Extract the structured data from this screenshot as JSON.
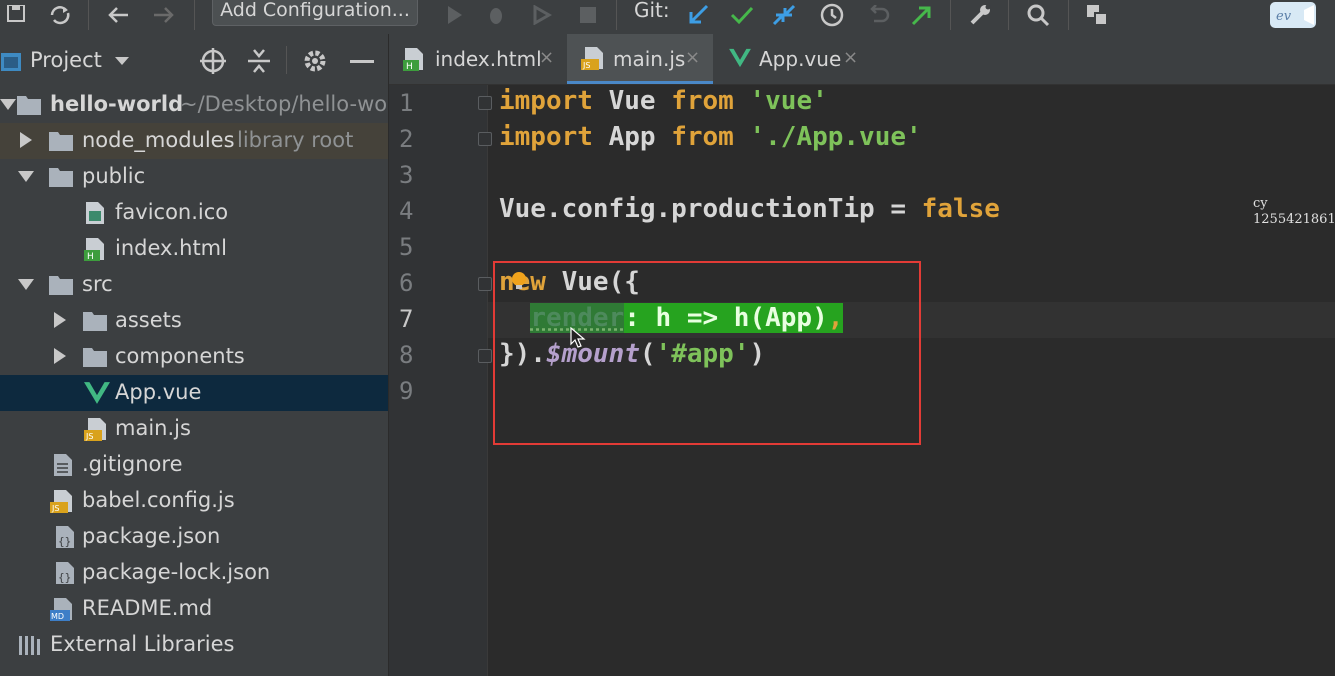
{
  "toolbar": {
    "config_label": "Add Configuration...",
    "git_label": "Git:"
  },
  "project": {
    "title": "Project",
    "tree": [
      {
        "label": "hello-world",
        "sub": "~/Desktop/hello-world",
        "type": "root-folder"
      },
      {
        "label": "node_modules",
        "sub": "library root",
        "type": "folder"
      },
      {
        "label": "public",
        "type": "folder"
      },
      {
        "label": "favicon.ico",
        "type": "image-file"
      },
      {
        "label": "index.html",
        "type": "html-file"
      },
      {
        "label": "src",
        "type": "folder"
      },
      {
        "label": "assets",
        "type": "folder"
      },
      {
        "label": "components",
        "type": "folder"
      },
      {
        "label": "App.vue",
        "type": "vue-file"
      },
      {
        "label": "main.js",
        "type": "js-file"
      },
      {
        "label": ".gitignore",
        "type": "text-file"
      },
      {
        "label": "babel.config.js",
        "type": "js-file"
      },
      {
        "label": "package.json",
        "type": "json-file"
      },
      {
        "label": "package-lock.json",
        "type": "json-file"
      },
      {
        "label": "README.md",
        "type": "md-file"
      },
      {
        "label": "External Libraries",
        "type": "library"
      }
    ]
  },
  "editor": {
    "tabs": [
      {
        "label": "index.html",
        "icon": "html-file-icon",
        "close": "×"
      },
      {
        "label": "main.js",
        "icon": "js-file-icon",
        "close": "×"
      },
      {
        "label": "App.vue",
        "icon": "vue-file-icon",
        "close": "×"
      }
    ],
    "line_numbers": [
      "1",
      "2",
      "3",
      "4",
      "5",
      "6",
      "7",
      "8",
      "9"
    ],
    "code": {
      "l1": {
        "kw1": "import",
        "name": " Vue ",
        "kw2": "from",
        "sp": " ",
        "str": "'vue'"
      },
      "l2": {
        "kw1": "import",
        "name": " App ",
        "kw2": "from",
        "sp": " ",
        "str": "'./App.vue'"
      },
      "l4": {
        "obj": "Vue.config.productionTip = ",
        "kw": "false"
      },
      "l6": {
        "kw": "new",
        "rest": " Vue({"
      },
      "l7": {
        "render": "render",
        "colon": ":",
        "body": " h => h(App)",
        "comma": ","
      },
      "l8": {
        "a": "}).",
        "method": "$mount",
        "b": "(",
        "str": "'#app'",
        "c": ")"
      }
    }
  },
  "watermark": {
    "line1": "cy",
    "line2": "1255421861"
  },
  "colors": {
    "keyword": "#e0a33a",
    "string": "#7ec25a",
    "highlight": "#26a31f",
    "annotation": "#e23b36",
    "selection": "#0d293e"
  }
}
